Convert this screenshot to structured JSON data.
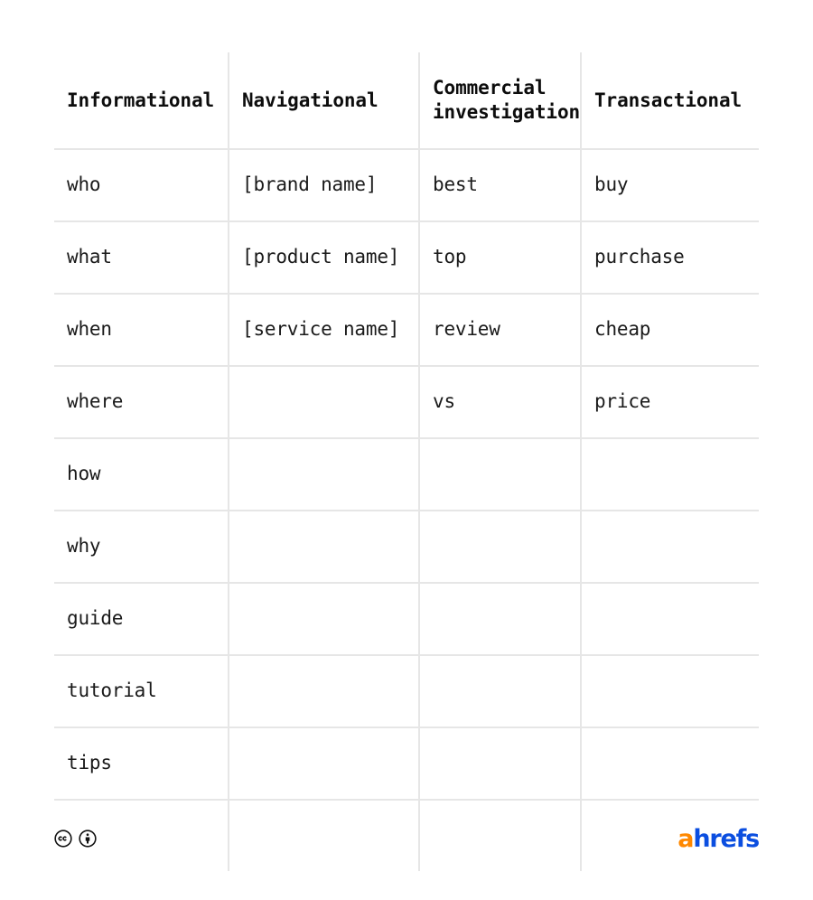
{
  "table": {
    "columns": [
      {
        "id": "informational",
        "label": "Informational"
      },
      {
        "id": "navigational",
        "label": "Navigational"
      },
      {
        "id": "commercial_investigation",
        "label": "Commercial investigation"
      },
      {
        "id": "transactional",
        "label": "Transactional"
      }
    ],
    "rows": [
      {
        "informational": "who",
        "navigational": "[brand name]",
        "commercial_investigation": "best",
        "transactional": "buy"
      },
      {
        "informational": "what",
        "navigational": "[product name]",
        "commercial_investigation": "top",
        "transactional": "purchase"
      },
      {
        "informational": "when",
        "navigational": "[service name]",
        "commercial_investigation": "review",
        "transactional": "cheap"
      },
      {
        "informational": "where",
        "navigational": "",
        "commercial_investigation": "vs",
        "transactional": "price"
      },
      {
        "informational": "how",
        "navigational": "",
        "commercial_investigation": "",
        "transactional": ""
      },
      {
        "informational": "why",
        "navigational": "",
        "commercial_investigation": "",
        "transactional": ""
      },
      {
        "informational": "guide",
        "navigational": "",
        "commercial_investigation": "",
        "transactional": ""
      },
      {
        "informational": "tutorial",
        "navigational": "",
        "commercial_investigation": "",
        "transactional": ""
      },
      {
        "informational": "tips",
        "navigational": "",
        "commercial_investigation": "",
        "transactional": ""
      }
    ]
  },
  "footer": {
    "license": {
      "icons": [
        "creative-commons-icon",
        "creative-commons-by-icon"
      ]
    },
    "brand": {
      "first_letter": "a",
      "rest": "hrefs",
      "accent_color": "#ff8800",
      "brand_color": "#0b4ee0"
    }
  },
  "colors": {
    "background": "#ffffff",
    "grid_line": "#e6e6e6",
    "header_text": "#0d0d0d",
    "body_text": "#1a1a1a"
  }
}
